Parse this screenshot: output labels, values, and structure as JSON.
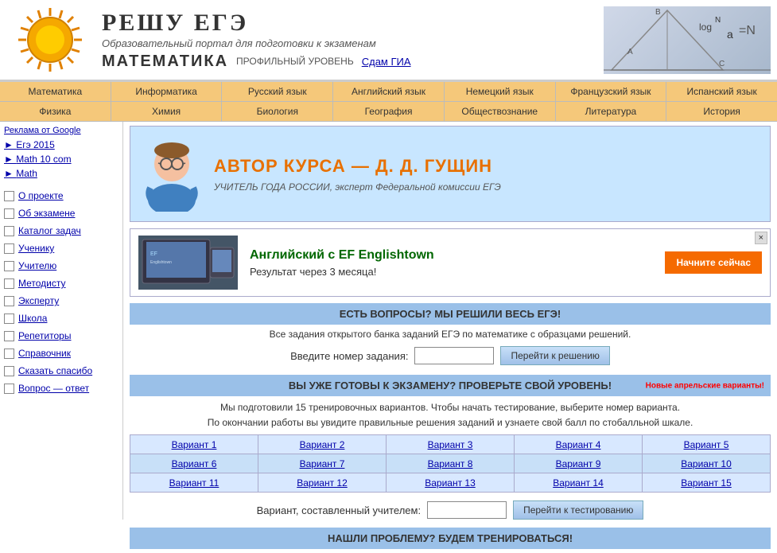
{
  "header": {
    "title": "РЕШУ ЕГЭ",
    "subtitle": "Образовательный портал для подготовки к экзаменам",
    "subject": "МАТЕМАТИКА",
    "level": "ПРОФИЛЬНЫЙ УРОВЕНЬ",
    "gia_link": "Сдам ГИА"
  },
  "nav1": {
    "items": [
      "Математика",
      "Информатика",
      "Русский язык",
      "Английский язык",
      "Немецкий язык",
      "Французский язык",
      "Испанский язык"
    ]
  },
  "nav2": {
    "items": [
      "Физика",
      "Химия",
      "Биология",
      "География",
      "Обществознание",
      "Литература",
      "История"
    ]
  },
  "sidebar": {
    "ads_label": "Реклама от Google",
    "ad_items": [
      "Егэ 2015",
      "Math 10 com",
      "Math"
    ],
    "nav_items": [
      "О проекте",
      "Об экзамене",
      "Каталог задач",
      "Ученику",
      "Учителю",
      "Методисту",
      "Эксперту",
      "Школа",
      "Репетиторы",
      "Справочник",
      "Сказать спасибо",
      "Вопрос — ответ"
    ]
  },
  "author_banner": {
    "title": "АВТОР КУРСА — Д. Д. ГУЩИН",
    "subtitle": "УЧИТЕЛЬ ГОДА РОССИИ, эксперт Федеральной комиссии ЕГЭ"
  },
  "ef_banner": {
    "title": "Английский с EF Englishtown",
    "subtitle": "Результат через 3 месяца!",
    "button": "Начните сейчас"
  },
  "questions_section": {
    "header": "ЕСТЬ ВОПРОСЫ? МЫ РЕШИЛИ ВЕСЬ ЕГЭ!",
    "sub": "Все задания открытого банка заданий ЕГЭ по математике с образцами решений.",
    "input_label": "Введите номер задания:",
    "button": "Перейти к решению"
  },
  "exam_section": {
    "header": "ВЫ УЖЕ ГОТОВЫ К ЭКЗАМЕНУ? ПРОВЕРЬТЕ СВОЙ УРОВЕНЬ!",
    "new_badge": "Новые апрельские варианты!",
    "desc_line1": "Мы подготовили 15 тренировочных вариантов. Чтобы начать тестирование, выберите номер варианта.",
    "desc_line2": "По окончании работы вы увидите правильные решения заданий и узнаете свой балл по стобалльной шкале.",
    "variants": [
      "Вариант 1",
      "Вариант 2",
      "Вариант 3",
      "Вариант 4",
      "Вариант 5",
      "Вариант 6",
      "Вариант 7",
      "Вариант 8",
      "Вариант 9",
      "Вариант 10",
      "Вариант 11",
      "Вариант 12",
      "Вариант 13",
      "Вариант 14",
      "Вариант 15"
    ],
    "teacher_label": "Вариант, составленный учителем:",
    "teacher_button": "Перейти к тестированию"
  },
  "problem_section": {
    "header": "НАШЛИ ПРОБЛЕМУ? БУДЕМ ТРЕНИРОВАТЬСЯ!"
  }
}
